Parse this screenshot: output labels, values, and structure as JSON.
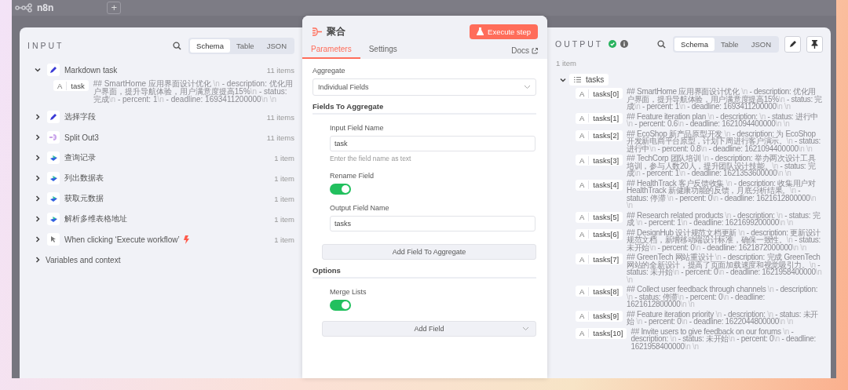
{
  "canvas": {
    "logo_text": "n8n",
    "add_button": "+"
  },
  "input": {
    "title": "INPUT",
    "view_tabs": [
      {
        "label": "Schema",
        "selected": true
      },
      {
        "label": "Table",
        "selected": false
      },
      {
        "label": "JSON",
        "selected": false
      }
    ],
    "nodes": [
      {
        "name": "Markdown task",
        "kind": "pencil",
        "count": "11 items",
        "expanded": true,
        "children": [
          {
            "type_badge": "A",
            "key": "task",
            "value": [
              "## SmartHome 应用界面设计优化 ",
              "\\n",
              " - description: 优化用户界面，提升导航体验，用户满意度提高15%",
              "\\n",
              " - status: 完成",
              "\\n",
              " - percent: 1",
              "\\n",
              " - deadline: 1693411200000",
              "\\n \\n"
            ]
          }
        ]
      },
      {
        "name": "选择字段",
        "kind": "pencil",
        "count": "11 items",
        "expanded": false
      },
      {
        "name": "Split Out3",
        "kind": "split",
        "count": "11 items",
        "expanded": false
      },
      {
        "name": "查询记录",
        "kind": "app",
        "count": "1 item",
        "expanded": false
      },
      {
        "name": "列出数据表",
        "kind": "app",
        "count": "1 item",
        "expanded": false
      },
      {
        "name": "获取元数据",
        "kind": "app",
        "count": "1 item",
        "expanded": false
      },
      {
        "name": "解析多维表格地址",
        "kind": "app",
        "count": "1 item",
        "expanded": false
      },
      {
        "name": "When clicking ‘Execute workflow’",
        "kind": "trigger",
        "count": "1 item",
        "expanded": false
      }
    ],
    "variables": {
      "label": "Variables and context",
      "expanded": false
    }
  },
  "node": {
    "title": "聚合",
    "execute_button": "Execute step",
    "tabs": [
      {
        "label": "Parameters",
        "selected": true
      },
      {
        "label": "Settings",
        "selected": false
      }
    ],
    "docs_link": "Docs",
    "aggregate": {
      "label": "Aggregate",
      "value": "Individual Fields"
    },
    "fields_section": "Fields To Aggregate",
    "input_field": {
      "label": "Input Field Name",
      "value": "task",
      "hint": "Enter the field name as text"
    },
    "rename_field": {
      "label": "Rename Field",
      "on": true
    },
    "output_field": {
      "label": "Output Field Name",
      "value": "tasks"
    },
    "add_field_to_aggregate": "Add Field To Aggregate",
    "options_section": "Options",
    "merge_lists": {
      "label": "Merge Lists",
      "on": true
    },
    "add_field": "Add Field"
  },
  "output": {
    "title": "OUTPUT",
    "view_tabs": [
      {
        "label": "Schema",
        "selected": true
      },
      {
        "label": "Table",
        "selected": false
      },
      {
        "label": "JSON",
        "selected": false
      }
    ],
    "count": "1 item",
    "root": {
      "key": "tasks",
      "expanded": true,
      "items": [
        {
          "type_badge": "A",
          "key": "tasks[0]",
          "value": [
            "## SmartHome 应用界面设计优化 ",
            "\\n",
            " - description: 优化用户界面，提升导航体验，用户满意度提高15%",
            "\\n",
            " - status: 完成",
            "\\n",
            " - percent: 1",
            "\\n",
            " - deadline: 1693411200000",
            "\\n \\n"
          ]
        },
        {
          "type_badge": "A",
          "key": "tasks[1]",
          "value": [
            "## Feature iteration plan ",
            "\\n",
            " - description: ",
            "\\n",
            " - status: 进行中 ",
            "\\n",
            " - percent: 0.6",
            "\\n",
            " - deadline: 1621094400000",
            "\\n \\n"
          ]
        },
        {
          "type_badge": "A",
          "key": "tasks[2]",
          "value": [
            "## EcoShop 新产品原型开发 ",
            "\\n",
            " - description: 为 EcoShop 开发新电商平台原型，计划下周进行客户演示。",
            "\\n",
            " - status: 进行中",
            "\\n",
            " - percent: 0.8",
            "\\n",
            " - deadline: 1621094400000",
            "\\n \\n"
          ]
        },
        {
          "type_badge": "A",
          "key": "tasks[3]",
          "value": [
            "## TechCorp 团队培训 ",
            "\\n",
            " - description: 举办两次设计工具培训，参与人数20人，提升团队设计技能。",
            "\\n",
            " - status: 完成",
            "\\n",
            " - percent: 1",
            "\\n",
            " - deadline: 1621353600000",
            "\\n \\n"
          ]
        },
        {
          "type_badge": "A",
          "key": "tasks[4]",
          "value": [
            "## HealthTrack 客户反馈收集 ",
            "\\n",
            " - description: 收集用户对 HealthTrack 新健康功能的反馈，月底分析结果。",
            "\\n",
            " - status: 停滞 ",
            "\\n",
            " - percent: 0",
            "\\n",
            " - deadline: 1621612800000",
            "\\n \\n"
          ]
        },
        {
          "type_badge": "A",
          "key": "tasks[5]",
          "value": [
            "## Research related products ",
            "\\n",
            " - description: ",
            "\\n",
            " - status: 完成 ",
            "\\n",
            " - percent: 1",
            "\\n",
            " - deadline: 1621699200000",
            "\\n \\n"
          ]
        },
        {
          "type_badge": "A",
          "key": "tasks[6]",
          "value": [
            "## DesignHub 设计规范文档更新 ",
            "\\n",
            " - description: 更新设计规范文档，新增移动端设计标准，确保一致性。",
            "\\n",
            " - status: 未开始",
            "\\n",
            " - percent: 0",
            "\\n",
            " - deadline: 1621872000000",
            "\\n \\n"
          ]
        },
        {
          "type_badge": "A",
          "key": "tasks[7]",
          "value": [
            "## GreenTech 网站重设计 ",
            "\\n",
            " - description: 完成 GreenTech 网站的全新设计，提高了页面加载速度和视觉吸引力。",
            "\\n",
            " - status: 未开始",
            "\\n",
            " - percent: 0",
            "\\n",
            " - deadline: 1621958400000",
            "\\n \\n"
          ]
        },
        {
          "type_badge": "A",
          "key": "tasks[8]",
          "value": [
            "## Collect user feedback through channels ",
            "\\n",
            " - description: ",
            "\\n",
            " - status: 停滞",
            "\\n",
            " - percent: 0",
            "\\n",
            " - deadline: 1621612800000",
            "\\n \\n"
          ]
        },
        {
          "type_badge": "A",
          "key": "tasks[9]",
          "value": [
            "## Feature iteration priority ",
            "\\n",
            " - description: ",
            "\\n",
            " - status: 未开始 ",
            "\\n",
            " - percent: 0",
            "\\n",
            " - deadline: 1622044800000",
            "\\n \\n"
          ]
        },
        {
          "type_badge": "A",
          "key": "tasks[10]",
          "value": [
            "## Invite users to give feedback on our forums ",
            "\\n",
            " - description: ",
            "\\n",
            " - status: 未开始",
            "\\n",
            " - percent: 0",
            "\\n",
            " - deadline: 1621958400000",
            "\\n \\n"
          ]
        }
      ]
    }
  }
}
